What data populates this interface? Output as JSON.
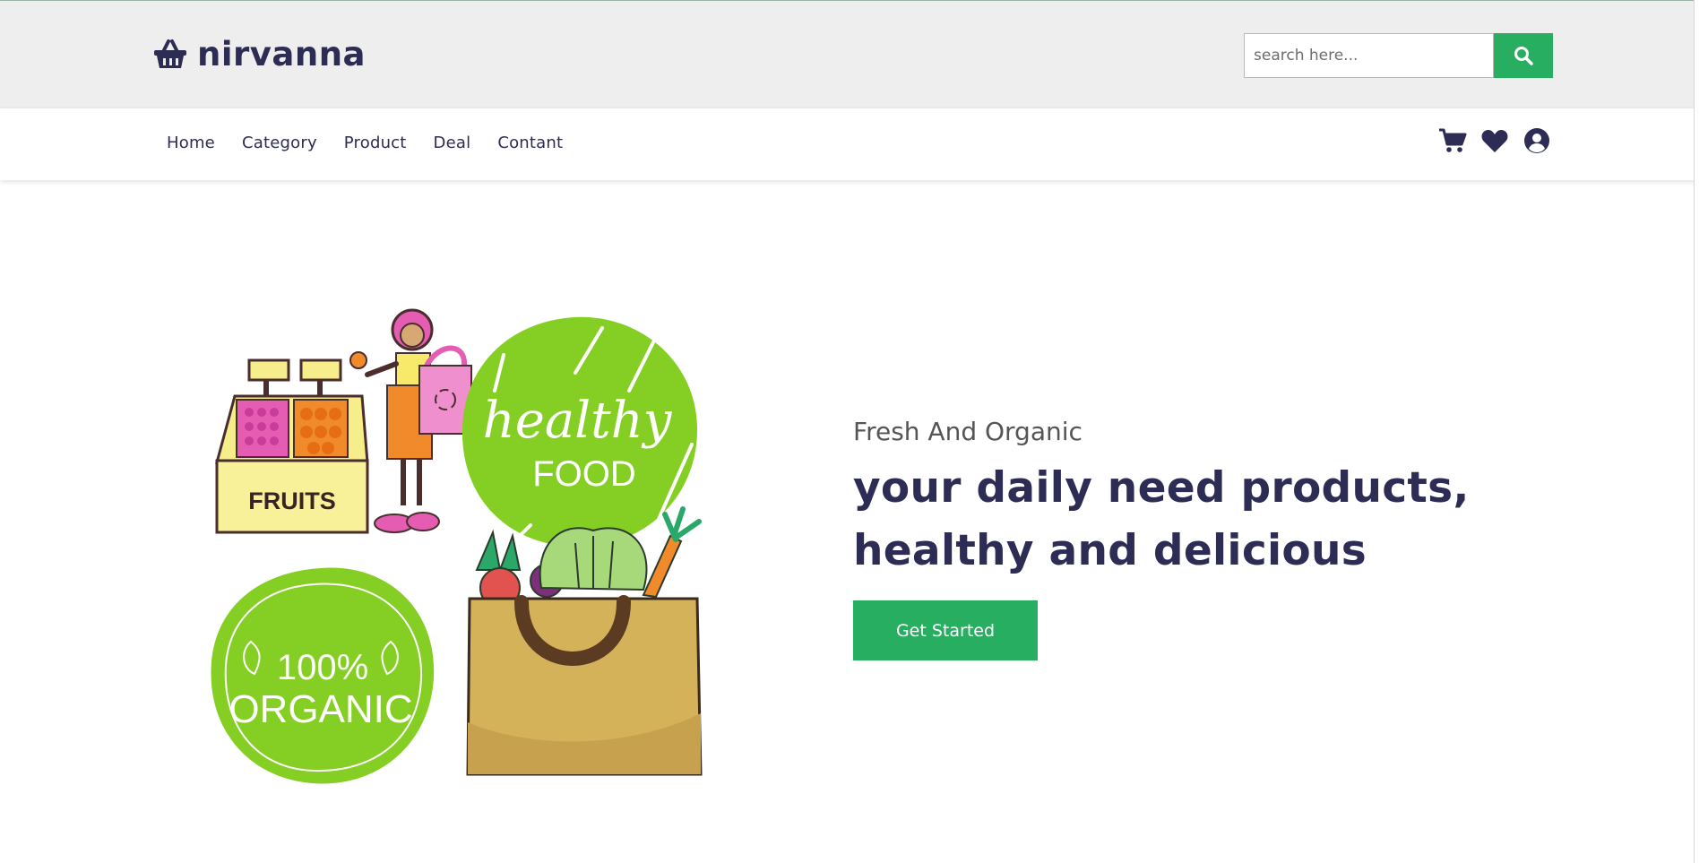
{
  "header": {
    "logo_text": "nirvanna",
    "logo_icon": "basket-icon",
    "search": {
      "placeholder": "search here...",
      "value": "",
      "button_icon": "search-icon"
    }
  },
  "nav": {
    "links": [
      "Home",
      "Category",
      "Product",
      "Deal",
      "Contant"
    ]
  },
  "user_icons": [
    "cart-icon",
    "heart-icon",
    "user-circle-icon"
  ],
  "hero": {
    "subtitle": "Fresh And Organic",
    "title": "your daily need products, healthy and delicious",
    "button_label": "Get Started",
    "illustration": {
      "stand_sign": "FRUITS",
      "badge_top_script": "healthy",
      "badge_top_caps": "FOOD",
      "badge_bottom_pct": "100%",
      "badge_bottom_caps": "ORGANIC"
    }
  },
  "colors": {
    "primary": "#27ae60",
    "dark": "#2c2c54",
    "light_bg": "#eeeeee",
    "lime": "#85cf24"
  }
}
